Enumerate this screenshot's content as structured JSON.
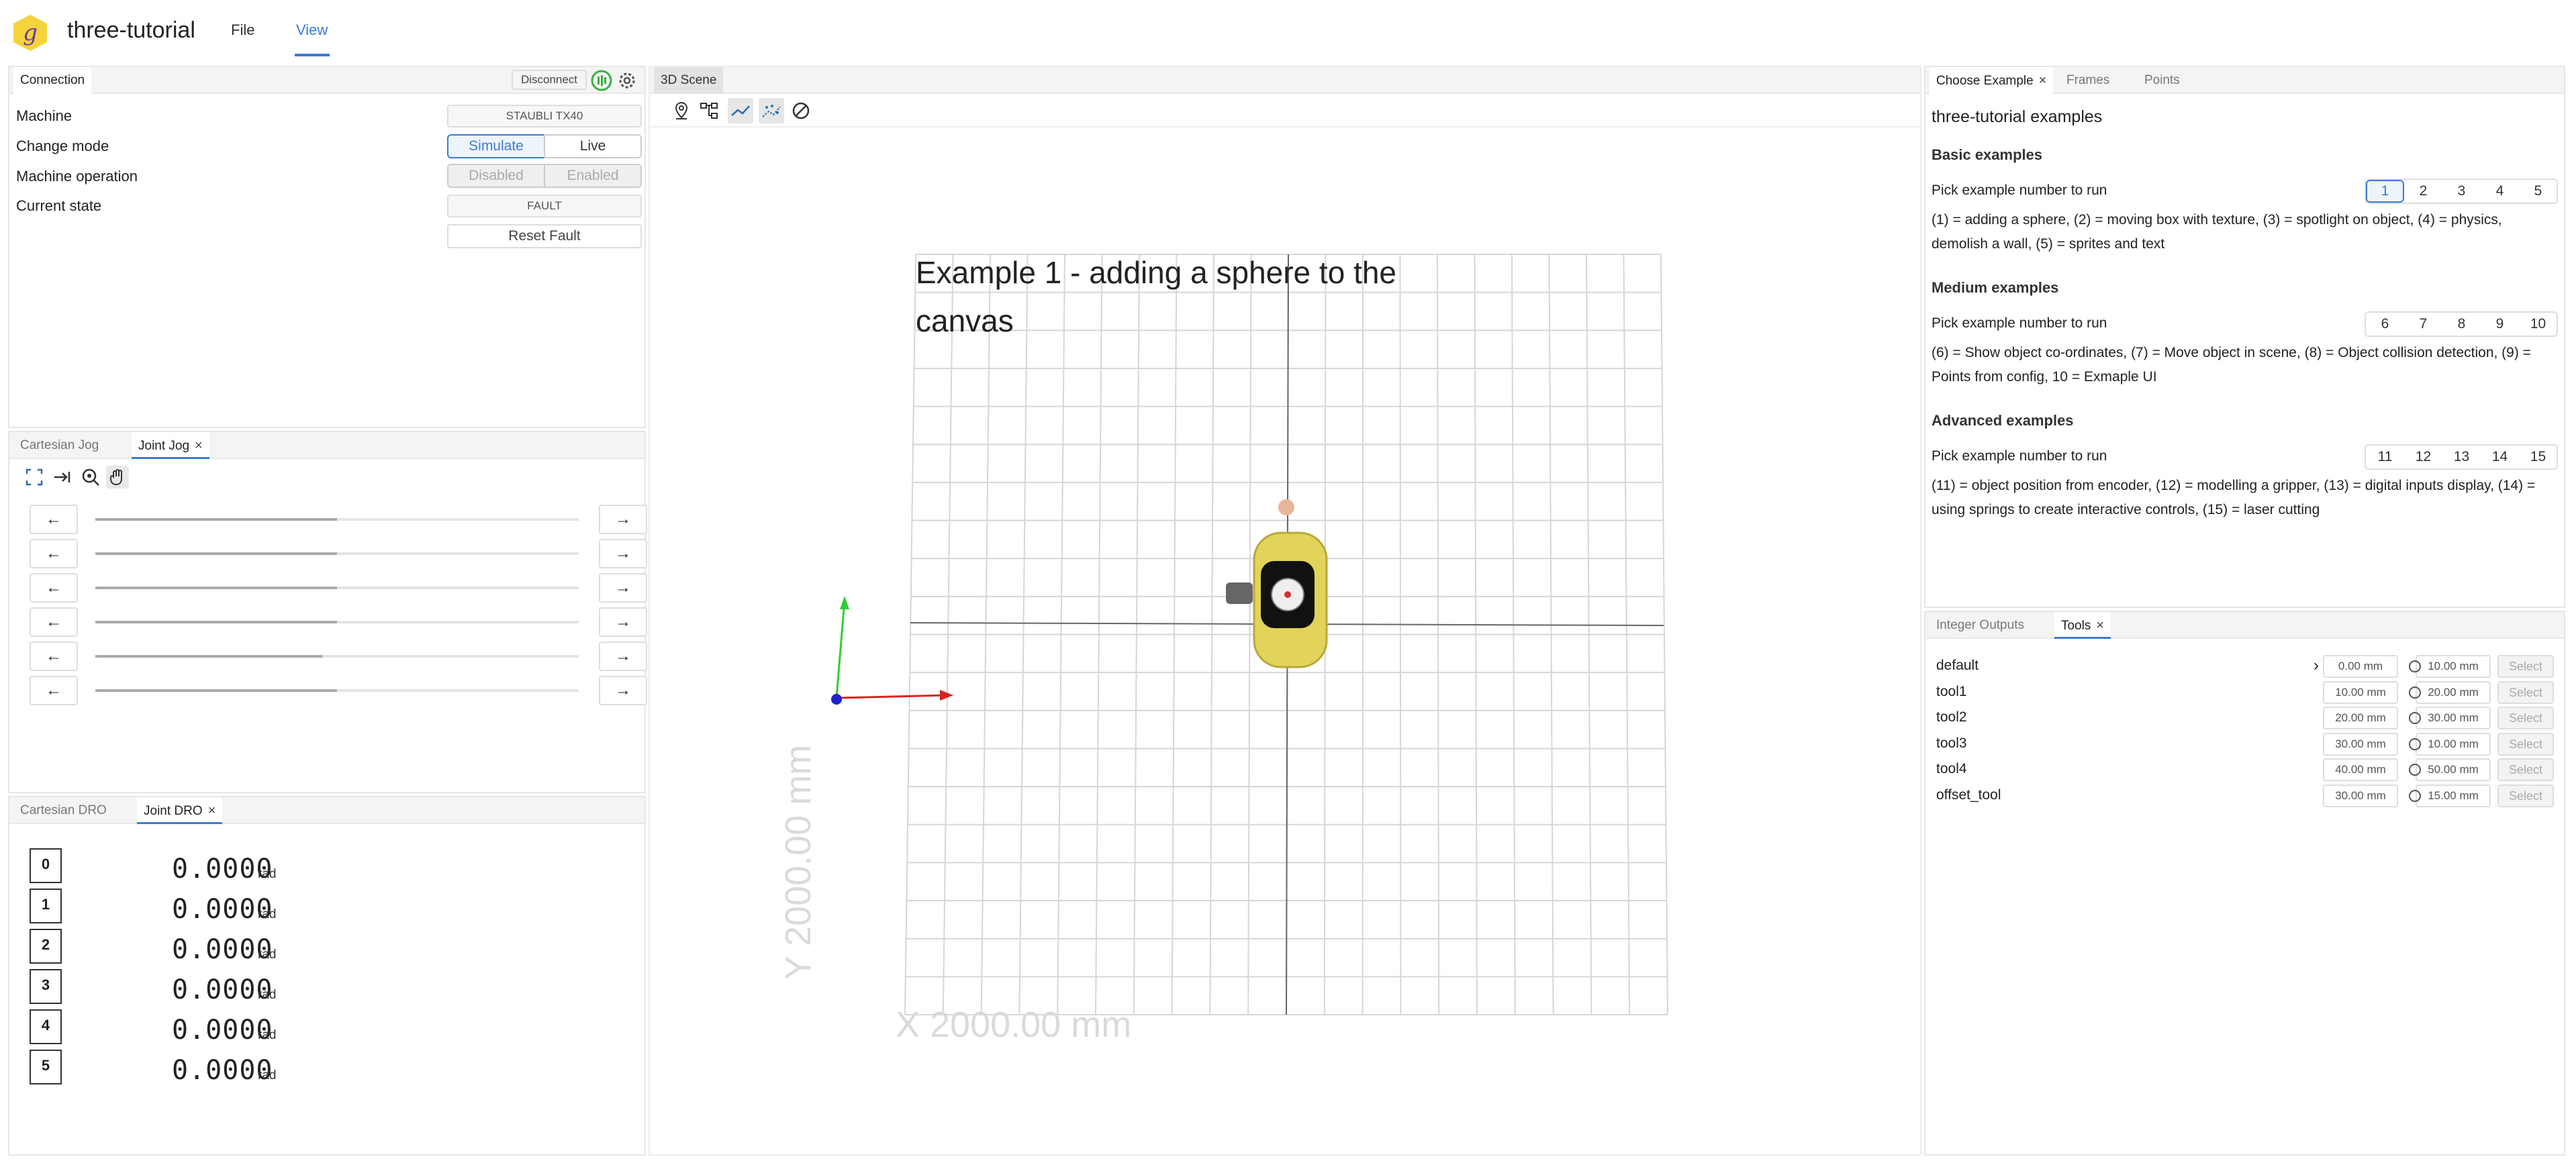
{
  "app": {
    "title": "three-tutorial",
    "logo_glyph": "g",
    "menu": [
      "File",
      "View"
    ],
    "active_menu": "View"
  },
  "connection": {
    "tab": "Connection",
    "disconnect": "Disconnect",
    "fields": {
      "machine_label": "Machine",
      "machine_value": "STAUBLI TX40",
      "mode_label": "Change mode",
      "mode_options": [
        "Simulate",
        "Live"
      ],
      "mode_selected": "Simulate",
      "operation_label": "Machine operation",
      "operation_options": [
        "Disabled",
        "Enabled"
      ],
      "state_label": "Current state",
      "state_value": "FAULT",
      "reset_label": "Reset Fault"
    }
  },
  "jog": {
    "tabs": [
      "Cartesian Jog",
      "Joint Jog"
    ],
    "active": "Joint Jog",
    "joints": [
      {
        "position": 0.5
      },
      {
        "position": 0.5
      },
      {
        "position": 0.5
      },
      {
        "position": 0.5
      },
      {
        "position": 0.47
      },
      {
        "position": 0.5
      }
    ]
  },
  "dro": {
    "tabs": [
      "Cartesian DRO",
      "Joint DRO"
    ],
    "active": "Joint DRO",
    "rows": [
      {
        "index": "0",
        "value": "0.0000",
        "unit": "rad"
      },
      {
        "index": "1",
        "value": "0.0000",
        "unit": "rad"
      },
      {
        "index": "2",
        "value": "0.0000",
        "unit": "rad"
      },
      {
        "index": "3",
        "value": "0.0000",
        "unit": "rad"
      },
      {
        "index": "4",
        "value": "0.0000",
        "unit": "rad"
      },
      {
        "index": "5",
        "value": "0.0000",
        "unit": "rad"
      }
    ]
  },
  "scene": {
    "tab": "3D Scene",
    "title": "Example 1 - adding a sphere to the canvas",
    "x_label": "X 2000.00 mm",
    "y_label": "Y 2000.00 mm"
  },
  "examples": {
    "tabs": [
      "Choose Example",
      "Frames",
      "Points"
    ],
    "active": "Choose Example",
    "title": "three-tutorial examples",
    "pick_label": "Pick example number to run",
    "groups": [
      {
        "heading": "Basic examples",
        "numbers": [
          "1",
          "2",
          "3",
          "4",
          "5"
        ],
        "selected": "1",
        "description": "(1) = adding a sphere, (2) = moving box with texture, (3) = spotlight on object, (4) = physics, demolish a wall, (5) = sprites and text"
      },
      {
        "heading": "Medium examples",
        "numbers": [
          "6",
          "7",
          "8",
          "9",
          "10"
        ],
        "selected": "",
        "description": "(6) = Show object co-ordinates, (7) = Move object in scene, (8) = Object collision detection, (9) = Points from config, 10 = Exmaple UI"
      },
      {
        "heading": "Advanced examples",
        "numbers": [
          "11",
          "12",
          "13",
          "14",
          "15"
        ],
        "selected": "",
        "description": "(11) = object position from encoder, (12) = modelling a gripper, (13) = digital inputs display, (14) = using springs to create interactive controls, (15) = laser cutting"
      }
    ]
  },
  "tools": {
    "tabs": [
      "Integer Outputs",
      "Tools"
    ],
    "active": "Tools",
    "select_label": "Select",
    "rows": [
      {
        "name": "default",
        "offset": "0.00 mm",
        "diameter": "10.00 mm",
        "current": true
      },
      {
        "name": "tool1",
        "offset": "10.00 mm",
        "diameter": "20.00 mm",
        "current": false
      },
      {
        "name": "tool2",
        "offset": "20.00 mm",
        "diameter": "30.00 mm",
        "current": false
      },
      {
        "name": "tool3",
        "offset": "30.00 mm",
        "diameter": "10.00 mm",
        "current": false
      },
      {
        "name": "tool4",
        "offset": "40.00 mm",
        "diameter": "50.00 mm",
        "current": false
      },
      {
        "name": "offset_tool",
        "offset": "30.00 mm",
        "diameter": "15.00 mm",
        "current": false
      }
    ]
  },
  "colors": {
    "accent": "#3a7bd5",
    "logo": "#f5d33b",
    "status_green": "#3cb043"
  }
}
